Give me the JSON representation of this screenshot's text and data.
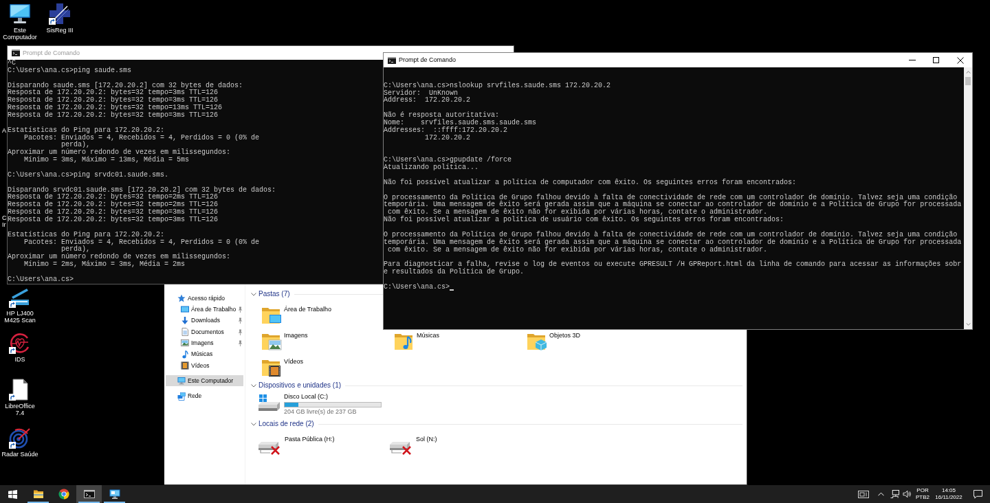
{
  "desktop_icons": [
    {
      "kind": "computer",
      "label": "Este Computador",
      "shortcut": false
    },
    {
      "kind": "sisreg",
      "label": "SisReg III",
      "shortcut": true
    },
    {
      "kind": "scanner",
      "label": "HP LJ400 M425 Scan",
      "shortcut": true
    },
    {
      "kind": "ids",
      "label": "IDS",
      "shortcut": true
    },
    {
      "kind": "libreoffice",
      "label": "LibreOffice 7.4",
      "shortcut": true
    },
    {
      "kind": "radar",
      "label": "Radar Saúde",
      "shortcut": true
    }
  ],
  "covered_icon_labels": [
    {
      "lines": [
        "A"
      ]
    },
    {
      "lines": [
        "C",
        "Ir"
      ]
    }
  ],
  "command_prompt_windows": [
    {
      "title": "Prompt de Comando",
      "active": false,
      "cursor": false,
      "lines": [
        {
          "kind": "text",
          "text": "^C"
        },
        {
          "kind": "text",
          "text": "C:\\Users\\ana.cs>ping saude.sms"
        },
        {
          "kind": "blank"
        },
        {
          "kind": "text",
          "text": "Disparando saude.sms [172.20.20.2] com 32 bytes de dados:"
        },
        {
          "kind": "text",
          "text": "Resposta de 172.20.20.2: bytes=32 tempo=3ms TTL=126"
        },
        {
          "kind": "text",
          "text": "Resposta de 172.20.20.2: bytes=32 tempo=3ms TTL=126"
        },
        {
          "kind": "text",
          "text": "Resposta de 172.20.20.2: bytes=32 tempo=13ms TTL=126"
        },
        {
          "kind": "text",
          "text": "Resposta de 172.20.20.2: bytes=32 tempo=3ms TTL=126"
        },
        {
          "kind": "blank"
        },
        {
          "kind": "text",
          "text": "Estatísticas do Ping para 172.20.20.2:"
        },
        {
          "kind": "text",
          "text": "    Pacotes: Enviados = 4, Recebidos = 4, Perdidos = 0 (0% de"
        },
        {
          "kind": "text",
          "text": "             perda),"
        },
        {
          "kind": "text",
          "text": "Aproximar um número redondo de vezes em milissegundos:"
        },
        {
          "kind": "text",
          "text": "    Mínimo = 3ms, Máximo = 13ms, Média = 5ms"
        },
        {
          "kind": "blank"
        },
        {
          "kind": "text",
          "text": "C:\\Users\\ana.cs>ping srvdc01.saude.sms."
        },
        {
          "kind": "blank"
        },
        {
          "kind": "text",
          "text": "Disparando srvdc01.saude.sms [172.20.20.2] com 32 bytes de dados:"
        },
        {
          "kind": "text",
          "text": "Resposta de 172.20.20.2: bytes=32 tempo=2ms TTL=126"
        },
        {
          "kind": "text",
          "text": "Resposta de 172.20.20.2: bytes=32 tempo=2ms TTL=126"
        },
        {
          "kind": "text",
          "text": "Resposta de 172.20.20.2: bytes=32 tempo=3ms TTL=126"
        },
        {
          "kind": "text",
          "text": "Resposta de 172.20.20.2: bytes=32 tempo=3ms TTL=126"
        },
        {
          "kind": "blank"
        },
        {
          "kind": "text",
          "text": "Estatísticas do Ping para 172.20.20.2:"
        },
        {
          "kind": "text",
          "text": "    Pacotes: Enviados = 4, Recebidos = 4, Perdidos = 0 (0% de"
        },
        {
          "kind": "text",
          "text": "             perda),"
        },
        {
          "kind": "text",
          "text": "Aproximar um número redondo de vezes em milissegundos:"
        },
        {
          "kind": "text",
          "text": "    Mínimo = 2ms, Máximo = 3ms, Média = 2ms"
        },
        {
          "kind": "blank"
        },
        {
          "kind": "text",
          "text": "C:\\Users\\ana.cs>"
        }
      ]
    },
    {
      "title": "Prompt de Comando",
      "active": true,
      "cursor": true,
      "lines": [
        {
          "kind": "blank"
        },
        {
          "kind": "blank"
        },
        {
          "kind": "text",
          "text": "C:\\Users\\ana.cs>nslookup srvfiles.saude.sms 172.20.20.2"
        },
        {
          "kind": "text",
          "text": "Servidor:  UnKnown"
        },
        {
          "kind": "text",
          "text": "Address:  172.20.20.2"
        },
        {
          "kind": "blank"
        },
        {
          "kind": "text",
          "text": "Não é resposta autoritativa:"
        },
        {
          "kind": "text",
          "text": "Nome:    srvfiles.saude.sms.saude.sms"
        },
        {
          "kind": "text",
          "text": "Addresses:  ::ffff:172.20.20.2"
        },
        {
          "kind": "text",
          "text": "          172.20.20.2"
        },
        {
          "kind": "blank"
        },
        {
          "kind": "blank"
        },
        {
          "kind": "text",
          "text": "C:\\Users\\ana.cs>gpupdate /force"
        },
        {
          "kind": "text",
          "text": "Atualizando política..."
        },
        {
          "kind": "blank"
        },
        {
          "kind": "text",
          "text": "Não foi possível atualizar a política de computador com êxito. Os seguintes erros foram encontrados:"
        },
        {
          "kind": "blank"
        },
        {
          "kind": "text",
          "text": "O processamento da Política de Grupo falhou devido à falta de conectividade de rede com um controlador de domínio. Talvez seja uma condição"
        },
        {
          "kind": "text",
          "text": "temporária. Uma mensagem de êxito será gerada assim que a máquina se conectar ao controlador de domínio e a Política de Grupo for processada"
        },
        {
          "kind": "text",
          "text": " com êxito. Se a mensagem de êxito não for exibida por várias horas, contate o administrador."
        },
        {
          "kind": "text",
          "text": "Não foi possível atualizar a política de usuário com êxito. Os seguintes erros foram encontrados:"
        },
        {
          "kind": "blank"
        },
        {
          "kind": "text",
          "text": "O processamento da Política de Grupo falhou devido à falta de conectividade de rede com um controlador de domínio. Talvez seja uma condição"
        },
        {
          "kind": "text",
          "text": "temporária. Uma mensagem de êxito será gerada assim que a máquina se conectar ao controlador de domínio e a Política de Grupo for processada"
        },
        {
          "kind": "text",
          "text": " com êxito. Se a mensagem de êxito não for exibida por várias horas, contate o administrador."
        },
        {
          "kind": "blank"
        },
        {
          "kind": "text",
          "text": "Para diagnosticar a falha, revise o log de eventos ou execute GPRESULT /H GPReport.html da linha de comando para acessar as informações sobr"
        },
        {
          "kind": "text",
          "text": "e resultados da Política de Grupo."
        },
        {
          "kind": "blank"
        },
        {
          "kind": "text",
          "text": "C:\\Users\\ana.cs>"
        }
      ]
    }
  ],
  "file_explorer": {
    "navigation": [
      {
        "kind": "star",
        "label": "Acesso rápido",
        "selected": false,
        "children": [
          {
            "kind": "desktop",
            "label": "Área de Trabalho",
            "selected": false,
            "pinned": true
          },
          {
            "kind": "downloads",
            "label": "Downloads",
            "selected": false,
            "pinned": true
          },
          {
            "kind": "documents",
            "label": "Documentos",
            "selected": false,
            "pinned": true
          },
          {
            "kind": "pictures",
            "label": "Imagens",
            "selected": false,
            "pinned": true
          },
          {
            "kind": "music",
            "label": "Músicas",
            "selected": false,
            "pinned": false
          },
          {
            "kind": "videos",
            "label": "Vídeos",
            "selected": false,
            "pinned": false
          }
        ]
      },
      {
        "kind": "computer",
        "label": "Este Computador",
        "selected": true
      },
      {
        "kind": "network",
        "label": "Rede",
        "selected": false
      }
    ],
    "sections": [
      {
        "kind": "folders",
        "title": "Pastas (7)",
        "expanded": true,
        "rows": [
          {
            "items": [
              {
                "kind": "desktop",
                "label": "Área de Trabalho"
              }
            ]
          },
          {
            "items": [
              {
                "kind": "pictures",
                "label": "Imagens"
              },
              {
                "kind": "music",
                "label": "Músicas"
              },
              {
                "kind": "objects",
                "label": "Objetos 3D"
              }
            ]
          },
          {
            "items": [
              {
                "kind": "videos",
                "label": "Vídeos"
              }
            ]
          }
        ]
      },
      {
        "kind": "drives",
        "title": "Dispositivos e unidades (1)",
        "expanded": true,
        "items": [
          {
            "label": "Disco Local (C:)",
            "level": 0.14,
            "free_space": "204 GB livre(s) de 237 GB"
          }
        ]
      },
      {
        "kind": "network_locations",
        "title": "Locais de rede (2)",
        "expanded": true,
        "items": [
          {
            "label": "Pasta Pública (H:)",
            "disconnected": true
          },
          {
            "label": "Sol (N:)",
            "disconnected": true
          }
        ]
      }
    ]
  },
  "taskbar": {
    "apps": [
      {
        "kind": "file_explorer",
        "running": true,
        "active": false
      },
      {
        "kind": "browser",
        "running": false,
        "active": false
      },
      {
        "kind": "terminal",
        "running": true,
        "active": true
      },
      {
        "kind": "monitor",
        "running": true,
        "active": false
      }
    ],
    "language": "POR",
    "keyboard_layout": "PTB2",
    "time": "14:05",
    "date": "16/11/2022"
  }
}
